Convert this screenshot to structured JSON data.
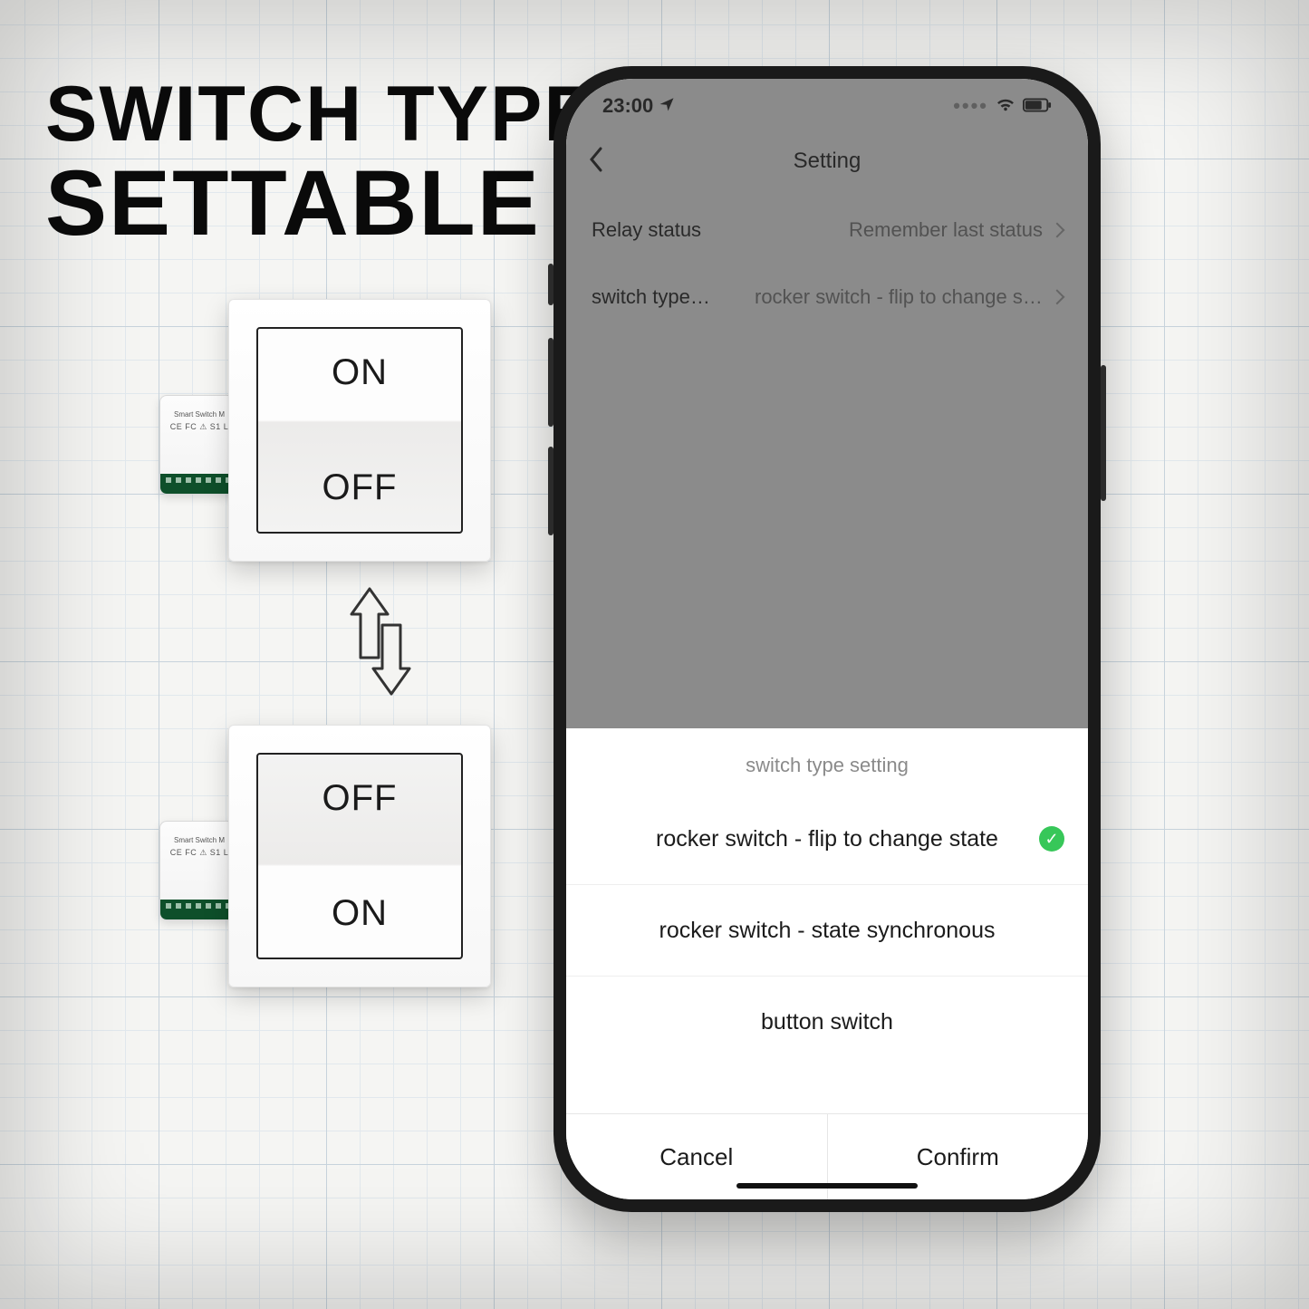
{
  "headline": {
    "line1": "SWITCH TYPE",
    "line2": "SETTABLE"
  },
  "switches": {
    "top": {
      "upper": "ON",
      "lower": "OFF"
    },
    "bottom": {
      "upper": "OFF",
      "lower": "ON"
    },
    "module": {
      "title": "Smart Switch M",
      "marks": "CE FC ⚠ S1 L"
    }
  },
  "phone": {
    "status": {
      "time": "23:00",
      "location_icon": "location-arrow",
      "wifi_icon": "wifi",
      "battery_icon": "battery"
    },
    "nav": {
      "title": "Setting",
      "back_icon": "chevron-left"
    },
    "rows": [
      {
        "label": "Relay status",
        "value": "Remember last status"
      },
      {
        "label": "switch type…",
        "value": "rocker switch - flip to change state"
      }
    ],
    "sheet": {
      "title": "switch type setting",
      "options": [
        {
          "label": "rocker switch - flip to change state",
          "selected": true
        },
        {
          "label": "rocker switch - state synchronous",
          "selected": false
        },
        {
          "label": "button switch",
          "selected": false
        }
      ],
      "cancel": "Cancel",
      "confirm": "Confirm"
    }
  }
}
